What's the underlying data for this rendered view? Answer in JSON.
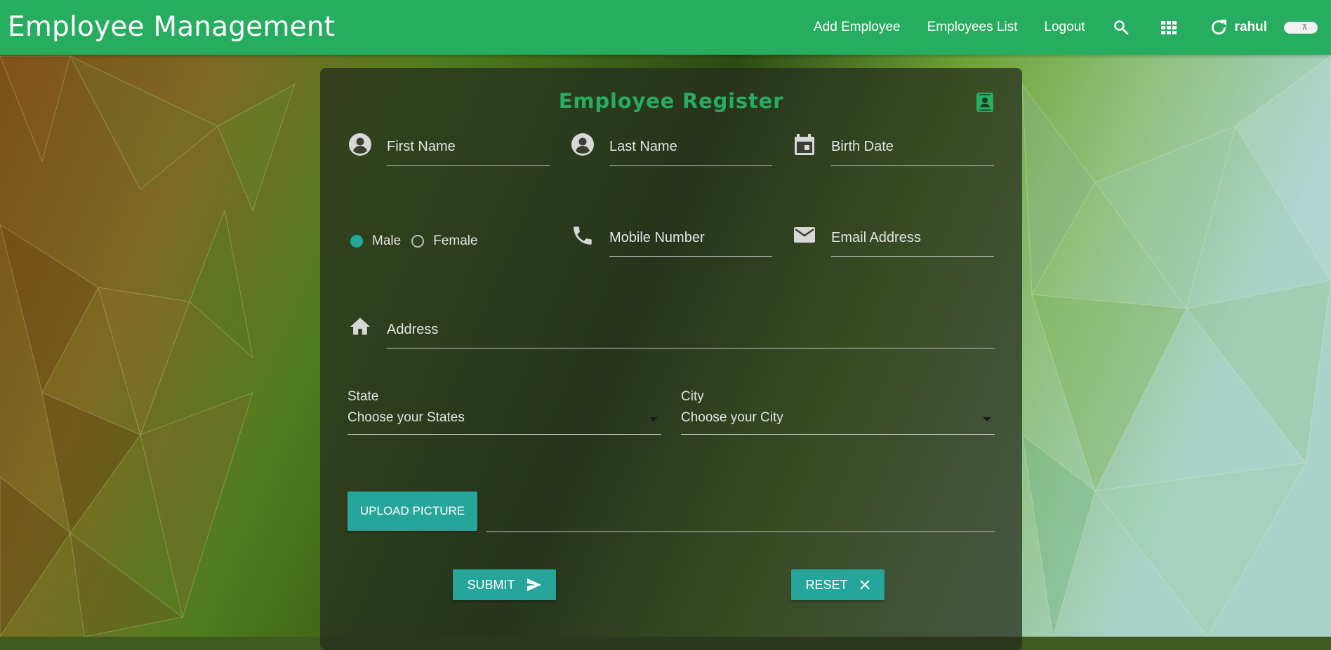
{
  "navbar": {
    "brand": "Employee Management",
    "links": [
      {
        "label": "Add Employee"
      },
      {
        "label": "Employees List"
      },
      {
        "label": "Logout"
      }
    ],
    "icons": [
      "search-icon",
      "apps-grid-icon",
      "refresh-icon"
    ],
    "username": "rahul",
    "toggle_icon": "theme-toggle-icon"
  },
  "form": {
    "title": "Employee Register",
    "header_icon": "contact-card-icon",
    "first_name": {
      "label": "First Name",
      "icon": "account-circle-icon"
    },
    "last_name": {
      "label": "Last Name",
      "icon": "account-circle-icon"
    },
    "birth_date": {
      "label": "Birth Date",
      "icon": "calendar-icon"
    },
    "gender": {
      "options": [
        {
          "label": "Male",
          "checked": true
        },
        {
          "label": "Female",
          "checked": false
        }
      ]
    },
    "mobile": {
      "label": "Mobile Number",
      "icon": "phone-icon"
    },
    "email": {
      "label": "Email Address",
      "icon": "mail-icon"
    },
    "address": {
      "label": "Address",
      "icon": "home-icon"
    },
    "state": {
      "label": "State",
      "value": "Choose your States"
    },
    "city": {
      "label": "City",
      "value": "Choose your City"
    },
    "upload_label": "Upload Picture",
    "submit_label": "Submit",
    "reset_label": "Reset"
  },
  "colors": {
    "navbar": "#26ad60",
    "title": "#26ad60",
    "button": "#26a69a",
    "card": "rgba(38,44,30,0.74)"
  }
}
